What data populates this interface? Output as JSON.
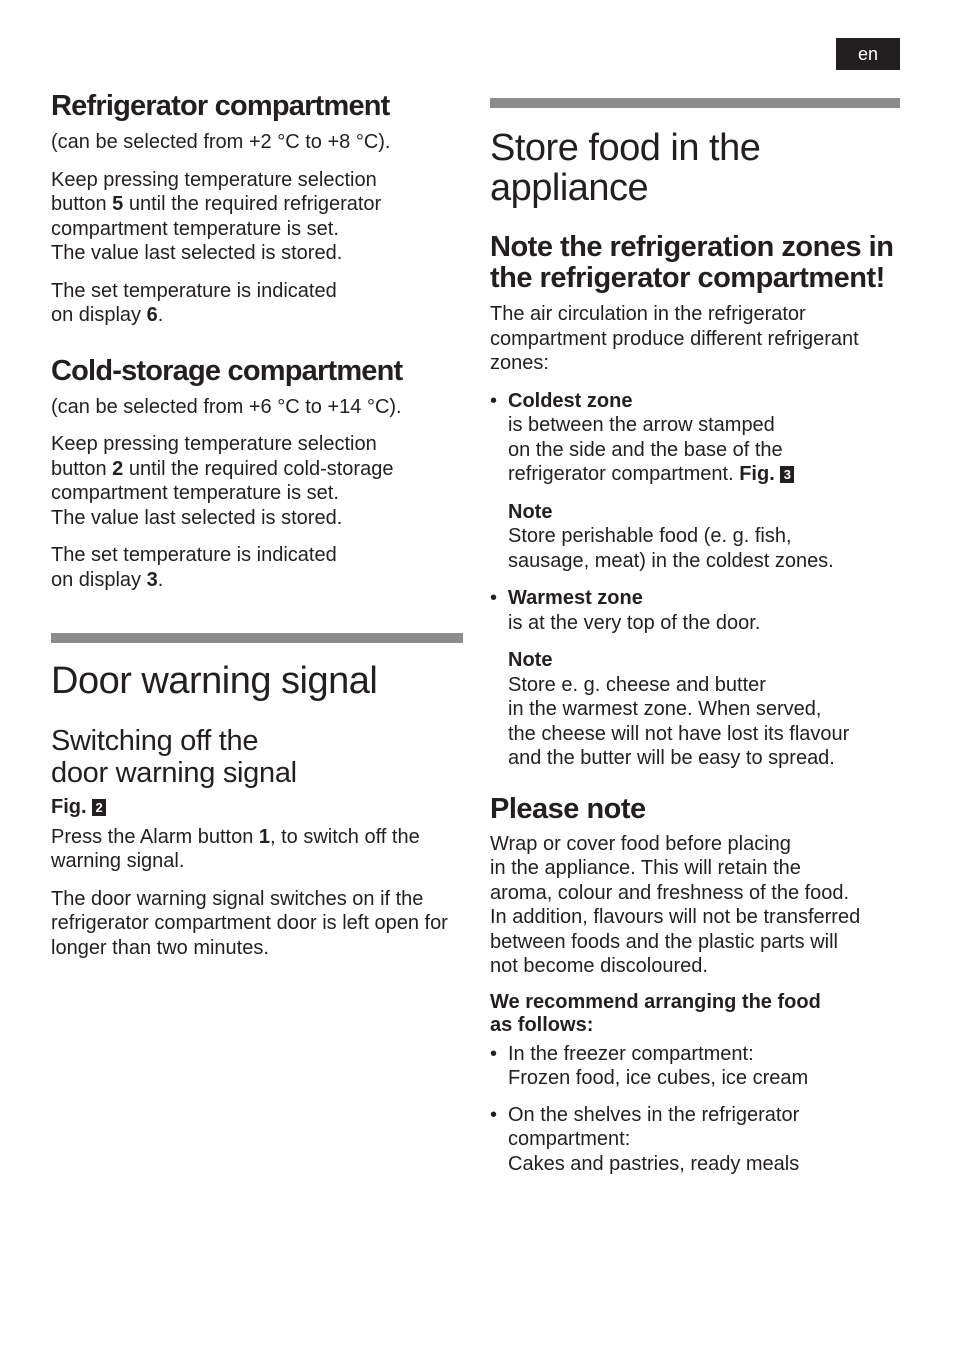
{
  "language_badge": "en",
  "left": {
    "refrigerator": {
      "heading": "Refrigerator compartment",
      "range": "(can be selected from +2 °C to +8 °C).",
      "instr_pre": "Keep pressing temperature selection\nbutton ",
      "instr_button": "5",
      "instr_post": " until the required refrigerator compartment temperature is set.\nThe value last selected is stored.",
      "display_pre": "The set temperature is indicated\non display ",
      "display_num": "6",
      "display_post": "."
    },
    "cold_storage": {
      "heading": "Cold-storage compartment",
      "range": "(can be selected from +6 °C to +14 °C).",
      "instr_pre": "Keep pressing temperature selection\nbutton ",
      "instr_button": "2",
      "instr_post": " until the required cold-storage compartment temperature is set.\nThe value last selected is stored.",
      "display_pre": "The set temperature is indicated\non display ",
      "display_num": "3",
      "display_post": "."
    },
    "door_warning": {
      "title": "Door warning signal",
      "subheading": "Switching off the\ndoor warning signal",
      "fig_label": "Fig.",
      "fig_num": "2",
      "press_pre": "Press the Alarm button ",
      "press_num": "1",
      "press_post": ", to switch off the warning signal.",
      "description": "The door warning signal switches on if the refrigerator compartment door is left open for longer than two minutes."
    }
  },
  "right": {
    "title": "Store food in the\nappliance",
    "zones_heading": "Note the refrigeration zones in the refrigerator compartment!",
    "zones_intro": "The air circulation in the refrigerator compartment produce different refrigerant zones:",
    "bullet_char": "•",
    "coldest": {
      "label": "Coldest zone",
      "text": "is between the arrow stamped\non the side and the base of the\nrefrigerator compartment. ",
      "fig_label": "Fig.",
      "fig_num": "3",
      "note_label": "Note",
      "note_text": "Store perishable food (e. g. fish,\nsausage, meat) in the coldest zones."
    },
    "warmest": {
      "label": "Warmest zone",
      "text": "is at the very top of the door.",
      "note_label": "Note",
      "note_text": "Store e. g. cheese and butter\nin the warmest zone. When served,\nthe cheese will not have lost its flavour\nand the butter will be easy to spread."
    },
    "please_note": {
      "heading": "Please note",
      "text": "Wrap or cover food before placing\nin the appliance. This will retain the\naroma, colour and freshness of the food.\nIn addition, flavours will not be transferred\nbetween foods and the plastic parts will\nnot become discoloured.",
      "recommend": "We recommend arranging the food\nas follows:",
      "items": [
        "In the freezer compartment:\nFrozen food, ice cubes, ice cream",
        "On the shelves in the refrigerator\ncompartment:\nCakes and pastries, ready meals"
      ]
    }
  }
}
